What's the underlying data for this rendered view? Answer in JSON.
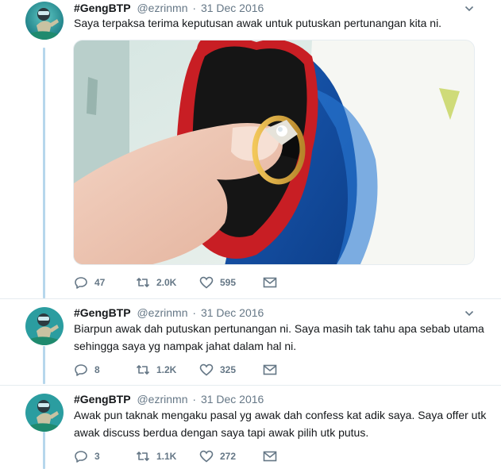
{
  "tweets": [
    {
      "display_name": "#GengBTP",
      "handle": "@ezrinmn",
      "separator": "·",
      "date": "31 Dec 2016",
      "text": "Saya terpaksa terima keputusan awak untuk putuskan pertunangan kita ni.",
      "has_media": true,
      "replies": "47",
      "retweets": "2.0K",
      "likes": "595"
    },
    {
      "display_name": "#GengBTP",
      "handle": "@ezrinmn",
      "separator": "·",
      "date": "31 Dec 2016",
      "text": "Biarpun awak dah putuskan pertunangan ni. Saya masih tak tahu apa sebab utama sehingga saya yg nampak jahat dalam hal ni.",
      "has_media": false,
      "replies": "8",
      "retweets": "1.2K",
      "likes": "325"
    },
    {
      "display_name": "#GengBTP",
      "handle": "@ezrinmn",
      "separator": "·",
      "date": "31 Dec 2016",
      "text": "Awak pun taknak mengaku pasal yg awak dah confess kat adik saya. Saya offer utk awak discuss berdua dengan saya tapi awak pilih utk putus.",
      "has_media": false,
      "replies": "3",
      "retweets": "1.1K",
      "likes": "272"
    }
  ],
  "icons": {
    "reply": "reply-icon",
    "retweet": "retweet-icon",
    "like": "heart-icon",
    "message": "envelope-icon",
    "caret": "chevron-down-icon"
  },
  "colors": {
    "text": "#14171a",
    "secondary": "#657786",
    "thread_line": "#b6d7ec",
    "border": "#e6ecf0"
  }
}
